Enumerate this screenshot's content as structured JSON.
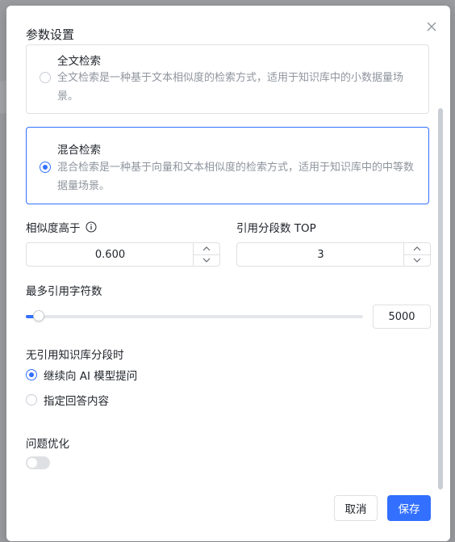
{
  "dialog": {
    "title": "参数设置",
    "close_icon": "close-icon"
  },
  "search_modes": [
    {
      "title": "全文检索",
      "description": "全文检索是一种基于文本相似度的检索方式，适用于知识库中的小数据量场景。",
      "selected": false
    },
    {
      "title": "混合检索",
      "description": "混合检索是一种基于向量和文本相似度的检索方式，适用于知识库中的中等数据量场景。",
      "selected": true
    }
  ],
  "similarity": {
    "label": "相似度高于",
    "info_icon": "info-circle-icon",
    "value": "0.600"
  },
  "top_segments": {
    "label": "引用分段数 TOP",
    "value": "3"
  },
  "max_chars": {
    "label": "最多引用字符数",
    "value": "5000",
    "slider_fraction": 0.03
  },
  "no_reference": {
    "label": "无引用知识库分段时",
    "options": [
      {
        "label": "继续向 AI 模型提问",
        "selected": true
      },
      {
        "label": "指定回答内容",
        "selected": false
      }
    ]
  },
  "question_optimize": {
    "label": "问题优化",
    "enabled": false
  },
  "footer": {
    "cancel_label": "取消",
    "save_label": "保存"
  },
  "colors": {
    "accent": "#3370ff",
    "muted_text": "#8f959e",
    "border": "#dee0e3"
  }
}
